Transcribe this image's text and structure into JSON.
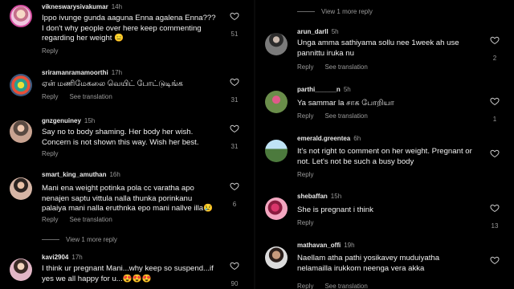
{
  "left": {
    "comments": [
      {
        "user": "vikneswarysivakumar",
        "time": "14h",
        "text": [
          "Ippo ivunge gunda aaguna Enna agalena Enna???",
          "I don't why people over here keep commenting",
          "regarding her weight 😑"
        ],
        "actions": [
          "Reply"
        ],
        "likes": "51"
      },
      {
        "user": "sriramanramamoorthi",
        "time": "17h",
        "text": [
          "ஏன் மணிமேகலை வெயிட் போட்டுடிங்க"
        ],
        "actions": [
          "Reply",
          "See translation"
        ],
        "likes": "31"
      },
      {
        "user": "gnzgenuiney",
        "time": "15h",
        "text": [
          "Say no to  body shaming. Her body her wish.",
          "Concern is not shown this way. Wish her best."
        ],
        "actions": [
          "Reply"
        ],
        "likes": "31"
      },
      {
        "user": "smart_king_amuthan",
        "time": "16h",
        "text": [
          "Mani ena weight potinka pola cc varatha apo",
          "nenajen saptu vittula nalla thunka porinkanu",
          "palaiya mani nalla eruthnka epo mani nallve illa😢"
        ],
        "actions": [
          "Reply",
          "See translation"
        ],
        "likes": "6"
      },
      {
        "user": "kavi2904",
        "time": "17h",
        "text": [
          "I think ur pregnant Mani...why keep so suspend...if",
          "yes we all happy for u...😍😍😍"
        ],
        "actions": [
          "Reply"
        ],
        "likes": "90"
      }
    ],
    "more_replies": "View 1 more reply"
  },
  "right": {
    "more_replies": "View 1 more reply",
    "comments": [
      {
        "user": "arun_darll",
        "time": "5h",
        "text": [
          "Unga amma sathiyama sollu nee 1week ah use",
          "pannittu iruka nu"
        ],
        "actions": [
          "Reply",
          "See translation"
        ],
        "likes": "2"
      },
      {
        "user": "parthi______n",
        "time": "5h",
        "text": [
          "Ya sammar la சாக போறியா"
        ],
        "actions": [
          "Reply",
          "See translation"
        ],
        "likes": "1"
      },
      {
        "user": "emerald.greentea",
        "time": "6h",
        "text": [
          "It's not right to comment on her weight. Pregnant or",
          "not. Let's not be such a busy body"
        ],
        "actions": [
          "Reply"
        ],
        "likes": ""
      },
      {
        "user": "shebaffan",
        "time": "15h",
        "text": [
          "She is pregnant i think"
        ],
        "actions": [
          "Reply"
        ],
        "likes": "13"
      },
      {
        "user": "mathavan_offi",
        "time": "19h",
        "text": [
          "Naellam atha pathi yosikavey muduiyatha",
          "nelamailla irukkom neenga vera akka"
        ],
        "actions": [
          "Reply",
          "See translation"
        ],
        "likes": ""
      }
    ]
  },
  "colors": {
    "background": "#000000",
    "text": "#f2f2f2",
    "muted": "#9a9a9a"
  },
  "icons": {
    "like": "heart-outline-icon"
  }
}
